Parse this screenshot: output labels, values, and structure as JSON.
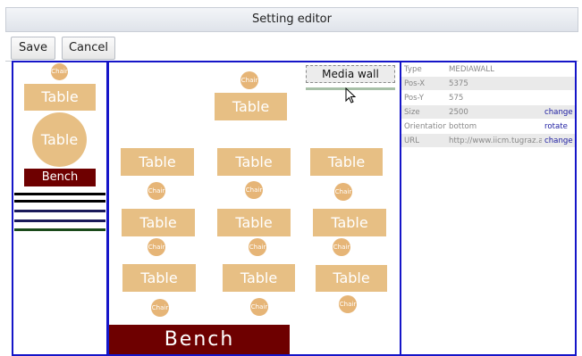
{
  "window": {
    "title": "Setting editor"
  },
  "toolbar": {
    "save_label": "Save",
    "cancel_label": "Cancel"
  },
  "palette": {
    "chair_label": "Chair",
    "table_label": "Table",
    "round_table_label": "Table",
    "bench_label": "Bench",
    "line_colors": [
      "#000000",
      "#000000",
      "#1a1a5a",
      "#1a1a5a",
      "#1a4a1a"
    ]
  },
  "canvas": {
    "chair_label": "Chair",
    "table_label": "Table",
    "bench_label": "Bench",
    "media_wall_label": "Media wall"
  },
  "properties": {
    "rows": [
      {
        "key": "Type",
        "value": "MEDIAWALL",
        "action": ""
      },
      {
        "key": "Pos-X",
        "value": "5375",
        "action": ""
      },
      {
        "key": "Pos-Y",
        "value": "575",
        "action": ""
      },
      {
        "key": "Size",
        "value": "2500",
        "action": "change"
      },
      {
        "key": "Orientation",
        "value": "bottom",
        "action": "rotate"
      },
      {
        "key": "URL",
        "value": "http://www.iicm.tugraz.at/",
        "action": "change"
      }
    ]
  },
  "colors": {
    "panel_border": "#1515c8",
    "table_fill": "#e7bf84",
    "chair_fill": "#e6b577",
    "bench_fill": "#6e0000",
    "action_link": "#1a1aa0"
  }
}
